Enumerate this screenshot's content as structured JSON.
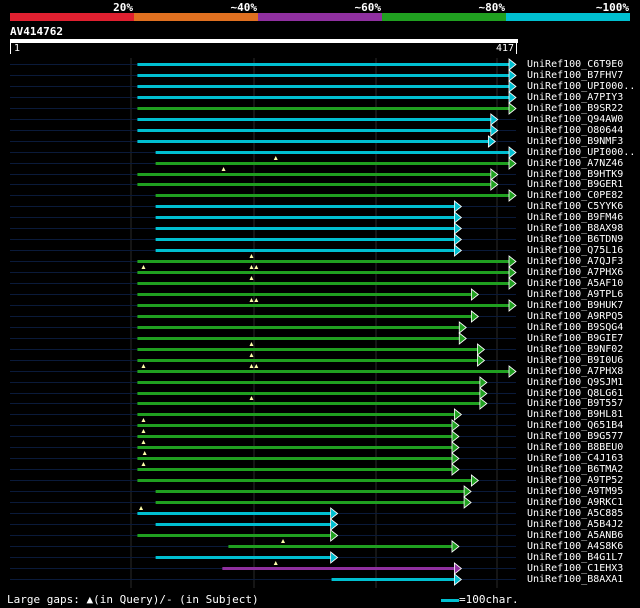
{
  "legend": {
    "segments": [
      {
        "label": "20%",
        "color": "#e02030"
      },
      {
        "label": "~40%",
        "color": "#e07020"
      },
      {
        "label": "~60%",
        "color": "#9030a0"
      },
      {
        "label": "~80%",
        "color": "#20a020"
      },
      {
        "label": "~100%",
        "color": "#00bfd0"
      }
    ]
  },
  "query": {
    "name": "AV414762",
    "start": "1",
    "end": "417",
    "length": 417
  },
  "colors": {
    "cyan": "#00bfd0",
    "green": "#20a020",
    "purple": "#9030a0",
    "gap": "#ffffaa",
    "bg_line": "#0a1a3a"
  },
  "hits": [
    {
      "name": "UniRef100_C6T9E0",
      "start": 105,
      "end": 417,
      "color": "cyan",
      "gaps": []
    },
    {
      "name": "UniRef100_B7FHV7",
      "start": 105,
      "end": 417,
      "color": "cyan",
      "gaps": []
    },
    {
      "name": "UniRef100_UPI000..",
      "start": 105,
      "end": 417,
      "color": "cyan",
      "gaps": []
    },
    {
      "name": "UniRef100_A7PIY3",
      "start": 105,
      "end": 417,
      "color": "cyan",
      "gaps": []
    },
    {
      "name": "UniRef100_B9SR22",
      "start": 105,
      "end": 417,
      "color": "green",
      "gaps": []
    },
    {
      "name": "UniRef100_Q94AW0",
      "start": 105,
      "end": 402,
      "color": "cyan",
      "gaps": []
    },
    {
      "name": "UniRef100_O80644",
      "start": 105,
      "end": 402,
      "color": "cyan",
      "gaps": []
    },
    {
      "name": "UniRef100_B9NMF3",
      "start": 105,
      "end": 400,
      "color": "cyan",
      "gaps": []
    },
    {
      "name": "UniRef100_UPI000..",
      "start": 120,
      "end": 417,
      "color": "cyan",
      "gaps": []
    },
    {
      "name": "UniRef100_A7NZ46",
      "start": 120,
      "end": 417,
      "color": "green",
      "gaps": [
        219
      ]
    },
    {
      "name": "UniRef100_B9HTK9",
      "start": 105,
      "end": 402,
      "color": "green",
      "gaps": [
        176
      ]
    },
    {
      "name": "UniRef100_B9GER1",
      "start": 105,
      "end": 402,
      "color": "green",
      "gaps": []
    },
    {
      "name": "UniRef100_C0PE82",
      "start": 120,
      "end": 417,
      "color": "green",
      "gaps": []
    },
    {
      "name": "UniRef100_C5YYK6",
      "start": 120,
      "end": 372,
      "color": "cyan",
      "gaps": []
    },
    {
      "name": "UniRef100_B9FM46",
      "start": 120,
      "end": 372,
      "color": "cyan",
      "gaps": []
    },
    {
      "name": "UniRef100_B8AX98",
      "start": 120,
      "end": 372,
      "color": "cyan",
      "gaps": []
    },
    {
      "name": "UniRef100_B6TDN9",
      "start": 120,
      "end": 372,
      "color": "cyan",
      "gaps": []
    },
    {
      "name": "UniRef100_Q75L16",
      "start": 120,
      "end": 372,
      "color": "cyan",
      "gaps": []
    },
    {
      "name": "UniRef100_A7QJF3",
      "start": 105,
      "end": 417,
      "color": "green",
      "gaps": [
        199
      ]
    },
    {
      "name": "UniRef100_A7PHX6",
      "start": 105,
      "end": 417,
      "color": "green",
      "gaps": [
        110,
        199,
        203
      ]
    },
    {
      "name": "UniRef100_A5AF10",
      "start": 105,
      "end": 417,
      "color": "green",
      "gaps": [
        199
      ]
    },
    {
      "name": "UniRef100_A9TPL6",
      "start": 105,
      "end": 386,
      "color": "green",
      "gaps": []
    },
    {
      "name": "UniRef100_B9HUK7",
      "start": 105,
      "end": 417,
      "color": "green",
      "gaps": [
        199,
        203
      ]
    },
    {
      "name": "UniRef100_A9RPQ5",
      "start": 105,
      "end": 386,
      "color": "green",
      "gaps": []
    },
    {
      "name": "UniRef100_B9SQG4",
      "start": 105,
      "end": 376,
      "color": "green",
      "gaps": []
    },
    {
      "name": "UniRef100_B9GIE7",
      "start": 105,
      "end": 376,
      "color": "green",
      "gaps": []
    },
    {
      "name": "UniRef100_B9NF02",
      "start": 105,
      "end": 391,
      "color": "green",
      "gaps": [
        199
      ]
    },
    {
      "name": "UniRef100_B9I0U6",
      "start": 105,
      "end": 391,
      "color": "green",
      "gaps": [
        199
      ]
    },
    {
      "name": "UniRef100_A7PHX8",
      "start": 105,
      "end": 417,
      "color": "green",
      "gaps": [
        110,
        199,
        203
      ]
    },
    {
      "name": "UniRef100_Q9SJM1",
      "start": 105,
      "end": 393,
      "color": "green",
      "gaps": []
    },
    {
      "name": "UniRef100_Q8LG61",
      "start": 105,
      "end": 393,
      "color": "green",
      "gaps": []
    },
    {
      "name": "UniRef100_B9T557",
      "start": 105,
      "end": 393,
      "color": "green",
      "gaps": [
        199
      ]
    },
    {
      "name": "UniRef100_B9HL81",
      "start": 105,
      "end": 372,
      "color": "green",
      "gaps": []
    },
    {
      "name": "UniRef100_Q651B4",
      "start": 105,
      "end": 370,
      "color": "green",
      "gaps": [
        110
      ]
    },
    {
      "name": "UniRef100_B9G577",
      "start": 105,
      "end": 370,
      "color": "green",
      "gaps": [
        110
      ]
    },
    {
      "name": "UniRef100_B8BEU0",
      "start": 105,
      "end": 370,
      "color": "green",
      "gaps": [
        110
      ]
    },
    {
      "name": "UniRef100_C4J163",
      "start": 105,
      "end": 370,
      "color": "green",
      "gaps": [
        111
      ]
    },
    {
      "name": "UniRef100_B6TMA2",
      "start": 105,
      "end": 370,
      "color": "green",
      "gaps": [
        110
      ]
    },
    {
      "name": "UniRef100_A9TP52",
      "start": 105,
      "end": 386,
      "color": "green",
      "gaps": []
    },
    {
      "name": "UniRef100_A9TM95",
      "start": 120,
      "end": 380,
      "color": "green",
      "gaps": []
    },
    {
      "name": "UniRef100_A9RKC1",
      "start": 120,
      "end": 380,
      "color": "green",
      "gaps": []
    },
    {
      "name": "UniRef100_A5C885",
      "start": 105,
      "end": 270,
      "color": "cyan",
      "gaps": [
        108
      ]
    },
    {
      "name": "UniRef100_A5B4J2",
      "start": 120,
      "end": 270,
      "color": "cyan",
      "gaps": []
    },
    {
      "name": "UniRef100_A5ANB6",
      "start": 105,
      "end": 270,
      "color": "green",
      "gaps": []
    },
    {
      "name": "UniRef100_A4S8K6",
      "start": 180,
      "end": 370,
      "color": "green",
      "gaps": [
        225
      ]
    },
    {
      "name": "UniRef100_B4G1L7",
      "start": 120,
      "end": 270,
      "color": "cyan",
      "gaps": []
    },
    {
      "name": "UniRef100_C1EHX3",
      "start": 175,
      "end": 372,
      "color": "purple",
      "gaps": [
        219
      ]
    },
    {
      "name": "UniRef100_B8AXA1",
      "start": 265,
      "end": 372,
      "color": "cyan",
      "gaps": []
    }
  ],
  "footer": {
    "text": "Large gaps: ▲(in Query)/- (in Subject)",
    "scale": "=100char."
  }
}
